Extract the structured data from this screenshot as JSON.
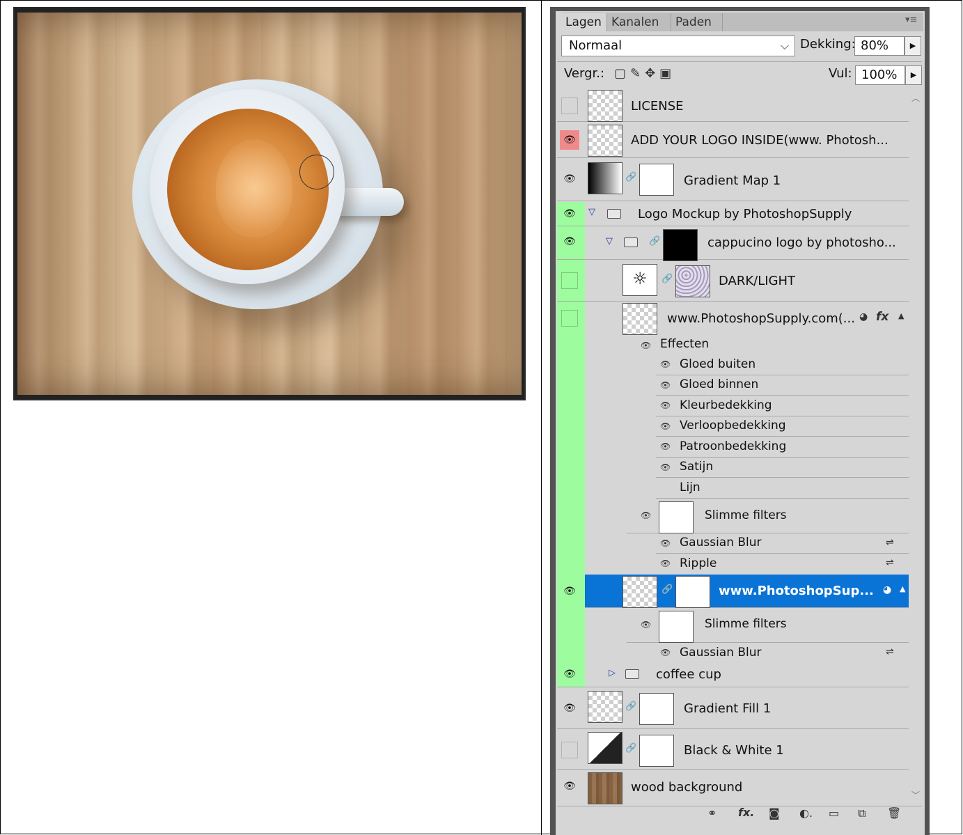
{
  "panel": {
    "tabs": [
      "Lagen",
      "Kanalen",
      "Paden"
    ],
    "blend_mode": "Normaal",
    "opacity_label": "Dekking:",
    "opacity_value": "80%",
    "lock_label": "Vergr.:",
    "fill_label": "Vul:",
    "fill_value": "100%"
  },
  "layers": {
    "license": "LICENSE",
    "add_logo": "ADD YOUR LOGO INSIDE(www. Photosh...",
    "gradient_map": "Gradient Map 1",
    "logo_mockup": "Logo Mockup by PhotoshopSupply",
    "cappucino": "cappucino logo by photosho...",
    "dark_light": "DARK/LIGHT",
    "ps_supply_1": "www.PhotoshopSupply.com(...",
    "effects_label": "Effecten",
    "effects": [
      "Gloed buiten",
      "Gloed binnen",
      "Kleurbedekking",
      "Verloopbedekking",
      "Patroonbedekking",
      "Satijn",
      "Lijn"
    ],
    "smart_filters": "Slimme filters",
    "filters_1": [
      "Gaussian Blur",
      "Ripple"
    ],
    "ps_supply_2": "www.PhotoshopSup...",
    "filters_2": [
      "Gaussian Blur"
    ],
    "coffee_cup": "coffee cup",
    "gradient_fill": "Gradient Fill 1",
    "black_white": "Black & White 1",
    "wood": "wood background"
  },
  "icons": [
    "eye-icon",
    "link-icon",
    "fx-icon",
    "mask-icon",
    "adjustment-icon",
    "folder-icon",
    "new-layer-icon",
    "trash-icon"
  ]
}
